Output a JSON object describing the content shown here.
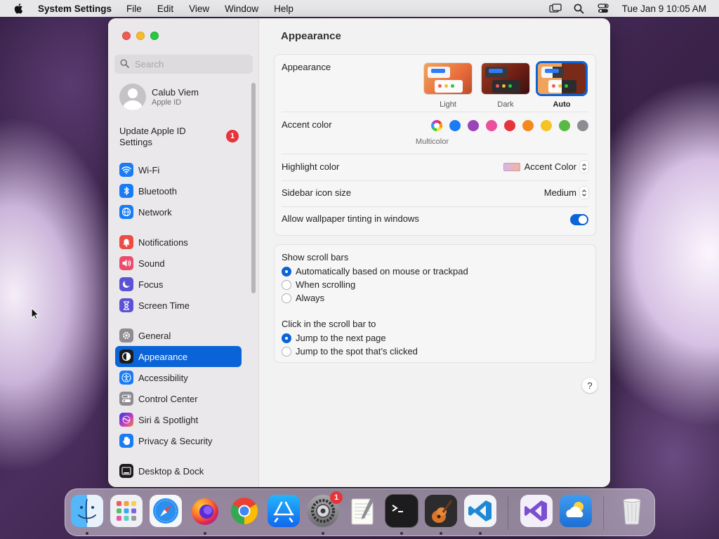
{
  "menubar": {
    "app_name": "System Settings",
    "menus": [
      "File",
      "Edit",
      "View",
      "Window",
      "Help"
    ],
    "clock": "Tue Jan 9  10:05 AM"
  },
  "sidebar": {
    "search_placeholder": "Search",
    "user": {
      "name": "Calub Viem",
      "subtitle": "Apple ID"
    },
    "update": {
      "label": "Update Apple ID Settings",
      "badge": "1"
    },
    "items": [
      {
        "label": "Wi-Fi",
        "icon": "wifi-icon",
        "color": "#1a7cf5"
      },
      {
        "label": "Bluetooth",
        "icon": "bluetooth-icon",
        "color": "#1a7cf5"
      },
      {
        "label": "Network",
        "icon": "globe-icon",
        "color": "#1a7cf5"
      },
      {
        "label": "Notifications",
        "icon": "bell-icon",
        "color": "#ee4b44"
      },
      {
        "label": "Sound",
        "icon": "speaker-icon",
        "color": "#ee4b6a"
      },
      {
        "label": "Focus",
        "icon": "moon-icon",
        "color": "#5b52d6"
      },
      {
        "label": "Screen Time",
        "icon": "hourglass-icon",
        "color": "#5b52d6"
      },
      {
        "label": "General",
        "icon": "gear-icon",
        "color": "#8e8c90"
      },
      {
        "label": "Appearance",
        "icon": "appearance-icon",
        "color": "#1c1c1e"
      },
      {
        "label": "Accessibility",
        "icon": "accessibility-icon",
        "color": "#1a7cf5"
      },
      {
        "label": "Control Center",
        "icon": "control-center-icon",
        "color": "#8e8c90"
      },
      {
        "label": "Siri & Spotlight",
        "icon": "siri-icon",
        "color": "#c23cc6"
      },
      {
        "label": "Privacy & Security",
        "icon": "hand-icon",
        "color": "#1a7cf5"
      },
      {
        "label": "Desktop & Dock",
        "icon": "dock-icon",
        "color": "#1c1c1e"
      }
    ],
    "active_item": "Appearance"
  },
  "main": {
    "title": "Appearance",
    "appearance": {
      "label": "Appearance",
      "options": [
        "Light",
        "Dark",
        "Auto"
      ],
      "selected": "Auto"
    },
    "accent": {
      "label": "Accent color",
      "colors": [
        "multicolor",
        "#1a7cf5",
        "#9a44b8",
        "#ec4f9c",
        "#e5343a",
        "#f4871e",
        "#f6c422",
        "#5ab944",
        "#8e8c90"
      ],
      "selected_label": "Multicolor"
    },
    "highlight": {
      "label": "Highlight color",
      "value": "Accent Color"
    },
    "sidebar_icon_size": {
      "label": "Sidebar icon size",
      "value": "Medium"
    },
    "wallpaper_tinting": {
      "label": "Allow wallpaper tinting in windows",
      "enabled": true
    },
    "scroll_bars": {
      "label": "Show scroll bars",
      "options": [
        "Automatically based on mouse or trackpad",
        "When scrolling",
        "Always"
      ],
      "selected": "Automatically based on mouse or trackpad"
    },
    "click_scroll": {
      "label": "Click in the scroll bar to",
      "options": [
        "Jump to the next page",
        "Jump to the spot that’s clicked"
      ],
      "selected": "Jump to the next page"
    },
    "help": "?"
  },
  "dock": {
    "apps": [
      {
        "name": "finder-icon",
        "color": "#3aa0f7",
        "running": true
      },
      {
        "name": "launchpad-icon",
        "color": "#eef0f4",
        "running": false
      },
      {
        "name": "safari-icon",
        "color": "#f4f6fa",
        "running": false
      },
      {
        "name": "firefox-icon",
        "color": "#7a3bd1",
        "running": true
      },
      {
        "name": "chrome-icon",
        "color": "#f4f4f4",
        "running": false
      },
      {
        "name": "app-store-icon",
        "color": "#1a8cf7",
        "running": false
      },
      {
        "name": "system-settings-icon",
        "color": "#8e8e93",
        "running": true,
        "badge": "1"
      },
      {
        "name": "textedit-icon",
        "color": "#f5f5f0",
        "running": false
      },
      {
        "name": "terminal-icon",
        "color": "#1c1c1e",
        "running": true
      },
      {
        "name": "garageband-icon",
        "color": "#2c2c2e",
        "running": true
      },
      {
        "name": "vscode-icon",
        "color": "#f2f4f8",
        "running": true
      },
      {
        "name": "visual-studio-icon",
        "color": "#f2eefa",
        "running": false
      },
      {
        "name": "weather-icon",
        "color": "#2f86e8",
        "running": false
      },
      {
        "name": "trash-icon",
        "color": "#e8e8ea",
        "running": false
      }
    ]
  }
}
